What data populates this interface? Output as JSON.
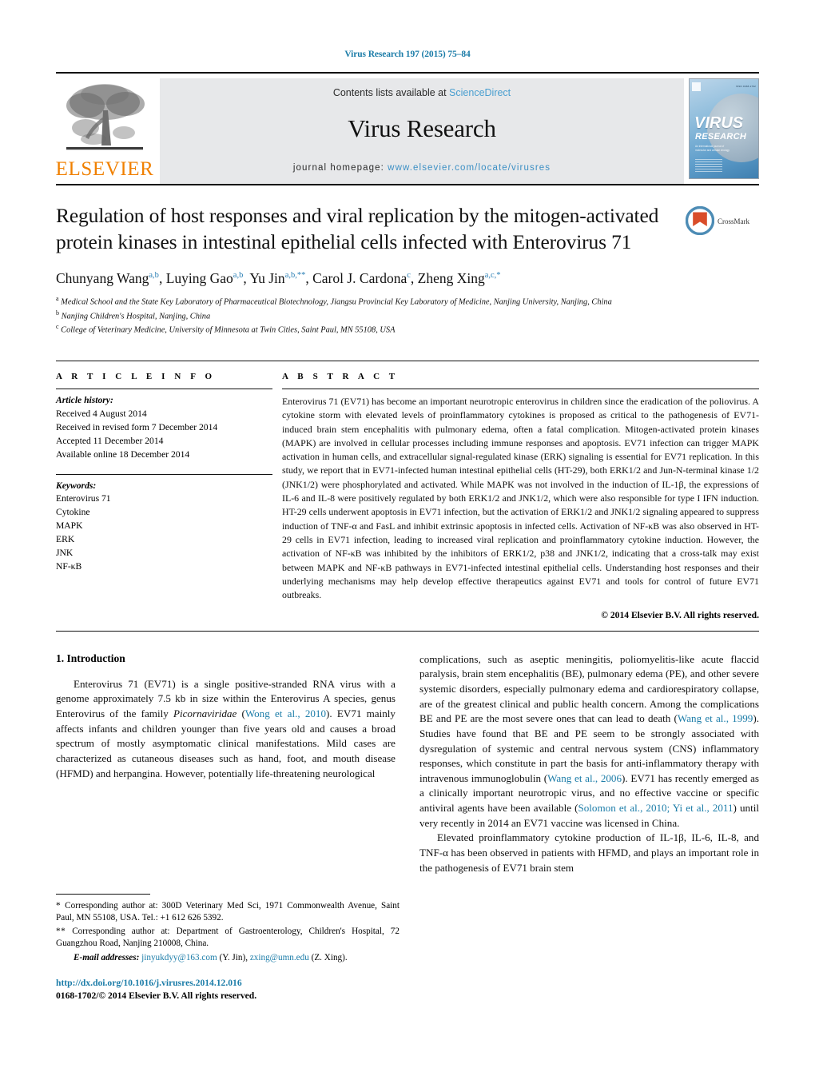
{
  "running_head": "Virus Research 197 (2015) 75–84",
  "masthead": {
    "publisher_logo_label": "ELSEVIER",
    "contents_prefix": "Contents lists available at ",
    "contents_link": "ScienceDirect",
    "journal_title": "Virus Research",
    "homepage_prefix": "journal homepage: ",
    "homepage_url": "www.elsevier.com/locate/virusres",
    "cover": {
      "title": "VIRUS",
      "subtitle": "RESEARCH",
      "top_left_micro": "ELSEVIER",
      "top_right_micro": "ISSN 0168-1702",
      "blurb": "An international journal of molecular and cellular virology",
      "colors": {
        "blue_dark": "#3f7fb0",
        "blue_light": "#bcd6ea"
      }
    }
  },
  "article": {
    "title": "Regulation of host responses and viral replication by the mitogen-activated protein kinases in intestinal epithelial cells infected with Enterovirus 71",
    "crossmark_label": "CrossMark",
    "authors_html": "Chunyang Wang<sup>a,b</sup>, Luying Gao<sup>a,b</sup>, Yu Jin<sup>a,b,**</sup>, Carol J. Cardona<sup>c</sup>, Zheng Xing<sup>a,c,*</sup>",
    "affiliations": [
      {
        "marker": "a",
        "text": "Medical School and the State Key Laboratory of Pharmaceutical Biotechnology, Jiangsu Provincial Key Laboratory of Medicine, Nanjing University, Nanjing, China"
      },
      {
        "marker": "b",
        "text": "Nanjing Children's Hospital, Nanjing, China"
      },
      {
        "marker": "c",
        "text": "College of Veterinary Medicine, University of Minnesota at Twin Cities, Saint Paul, MN 55108, USA"
      }
    ]
  },
  "article_info": {
    "heading": "A R T I C L E  I N F O",
    "history_heading": "Article history:",
    "history": [
      "Received 4 August 2014",
      "Received in revised form 7 December 2014",
      "Accepted 11 December 2014",
      "Available online 18 December 2014"
    ],
    "keywords_heading": "Keywords:",
    "keywords": [
      "Enterovirus 71",
      "Cytokine",
      "MAPK",
      "ERK",
      "JNK",
      "NF-κB"
    ]
  },
  "abstract": {
    "heading": "A B S T R A C T",
    "text": "Enterovirus 71 (EV71) has become an important neurotropic enterovirus in children since the eradication of the poliovirus. A cytokine storm with elevated levels of proinflammatory cytokines is proposed as critical to the pathogenesis of EV71-induced brain stem encephalitis with pulmonary edema, often a fatal complication. Mitogen-activated protein kinases (MAPK) are involved in cellular processes including immune responses and apoptosis. EV71 infection can trigger MAPK activation in human cells, and extracellular signal-regulated kinase (ERK) signaling is essential for EV71 replication. In this study, we report that in EV71-infected human intestinal epithelial cells (HT-29), both ERK1/2 and Jun-N-terminal kinase 1/2 (JNK1/2) were phosphorylated and activated. While MAPK was not involved in the induction of IL-1β, the expressions of IL-6 and IL-8 were positively regulated by both ERK1/2 and JNK1/2, which were also responsible for type I IFN induction. HT-29 cells underwent apoptosis in EV71 infection, but the activation of ERK1/2 and JNK1/2 signaling appeared to suppress induction of TNF-α and FasL and inhibit extrinsic apoptosis in infected cells. Activation of NF-κB was also observed in HT-29 cells in EV71 infection, leading to increased viral replication and proinflammatory cytokine induction. However, the activation of NF-κB was inhibited by the inhibitors of ERK1/2, p38 and JNK1/2, indicating that a cross-talk may exist between MAPK and NF-κB pathways in EV71-infected intestinal epithelial cells. Understanding host responses and their underlying mechanisms may help develop effective therapeutics against EV71 and tools for control of future EV71 outbreaks.",
    "copyright": "© 2014 Elsevier B.V. All rights reserved."
  },
  "body": {
    "section_heading": "1.  Introduction",
    "left_paragraph_parts": {
      "p1_a": "Enterovirus 71 (EV71) is a single positive-stranded RNA virus with a genome approximately 7.5 kb in size within the Enterovirus A species, genus Enterovirus of the family ",
      "p1_italic": "Picornaviridae",
      "p1_b": " (",
      "p1_ref": "Wong et al., 2010",
      "p1_c": "). EV71 mainly affects infants and children younger than five years old and causes a broad spectrum of mostly asymptomatic clinical manifestations. Mild cases are characterized as cutaneous diseases such as hand, foot, and mouth disease (HFMD) and herpangina. However, potentially life-threatening neurological"
    },
    "right_paragraph_parts": {
      "p2_a": "complications, such as aseptic meningitis, poliomyelitis-like acute flaccid paralysis, brain stem encephalitis (BE), pulmonary edema (PE), and other severe systemic disorders, especially pulmonary edema and cardiorespiratory collapse, are of the greatest clinical and public health concern. Among the complications BE and PE are the most severe ones that can lead to death (",
      "p2_ref1": "Wang et al., 1999",
      "p2_b": "). Studies have found that BE and PE seem to be strongly associated with dysregulation of systemic and central nervous system (CNS) inflammatory responses, which constitute in part the basis for anti-inflammatory therapy with intravenous immunoglobulin (",
      "p2_ref2": "Wang et al., 2006",
      "p2_c": "). EV71 has recently emerged as a clinically important neurotropic virus, and no effective vaccine or specific antiviral agents have been available (",
      "p2_ref3": "Solomon et al., 2010; Yi et al., 2011",
      "p2_d": ") until very recently in 2014 an EV71 vaccine was licensed in China.",
      "p3": "Elevated proinflammatory cytokine production of IL-1β, IL-6, IL-8, and TNF-α has been observed in patients with HFMD, and plays an important role in the pathogenesis of EV71 brain stem"
    }
  },
  "footnotes": {
    "fn1_marker": "*",
    "fn1_text": "Corresponding author at: 300D Veterinary Med Sci, 1971 Commonwealth Avenue, Saint Paul, MN 55108, USA. Tel.: +1 612 626 5392.",
    "fn2_marker": "**",
    "fn2_text": "Corresponding author at: Department of Gastroenterology, Children's Hospital, 72 Guangzhou Road, Nanjing 210008, China.",
    "email_label": "E-mail addresses:",
    "email1": "jinyukdyy@163.com",
    "email1_owner": "(Y. Jin),",
    "email2": "zxing@umn.edu",
    "email2_owner": "(Z. Xing)."
  },
  "doi_block": {
    "doi_url": "http://dx.doi.org/10.1016/j.virusres.2014.12.016",
    "issn_line": "0168-1702/© 2014 Elsevier B.V. All rights reserved."
  }
}
